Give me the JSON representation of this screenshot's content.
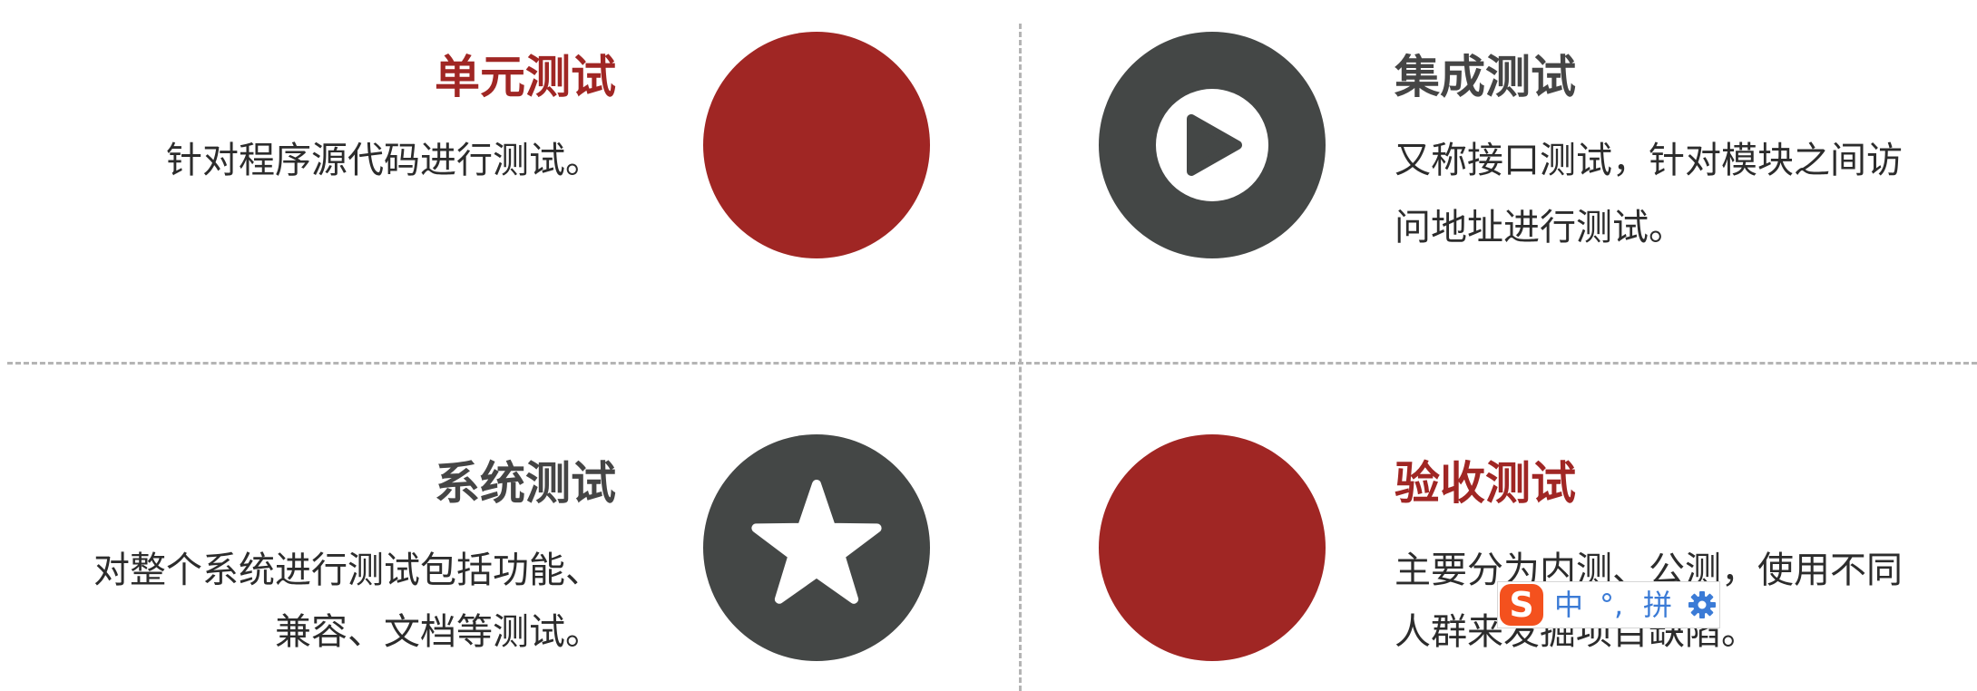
{
  "sections": {
    "unit": {
      "title": "单元测试",
      "desc_lines": [
        "针对程序源代码进行测试。"
      ]
    },
    "integration": {
      "title": "集成测试",
      "icon": "play-icon",
      "desc_lines": [
        "又称接口测试，针对模块之间访",
        "问地址进行测试。"
      ]
    },
    "system": {
      "title": "系统测试",
      "icon": "star-icon",
      "desc_lines": [
        "对整个系统进行测试包括功能、",
        "兼容、文档等测试。"
      ]
    },
    "acceptance": {
      "title": "验收测试",
      "desc_lines": [
        "主要分为内测、公测，使用不同",
        "人群来发掘项目缺陷。"
      ]
    }
  },
  "ime_toolbar": {
    "logo": "S",
    "language": "中",
    "punctuation": "°,",
    "mode": "拼",
    "settings_icon": "gear-icon"
  },
  "colors": {
    "accent_red": "#a02624",
    "dark_gray": "#444746"
  }
}
